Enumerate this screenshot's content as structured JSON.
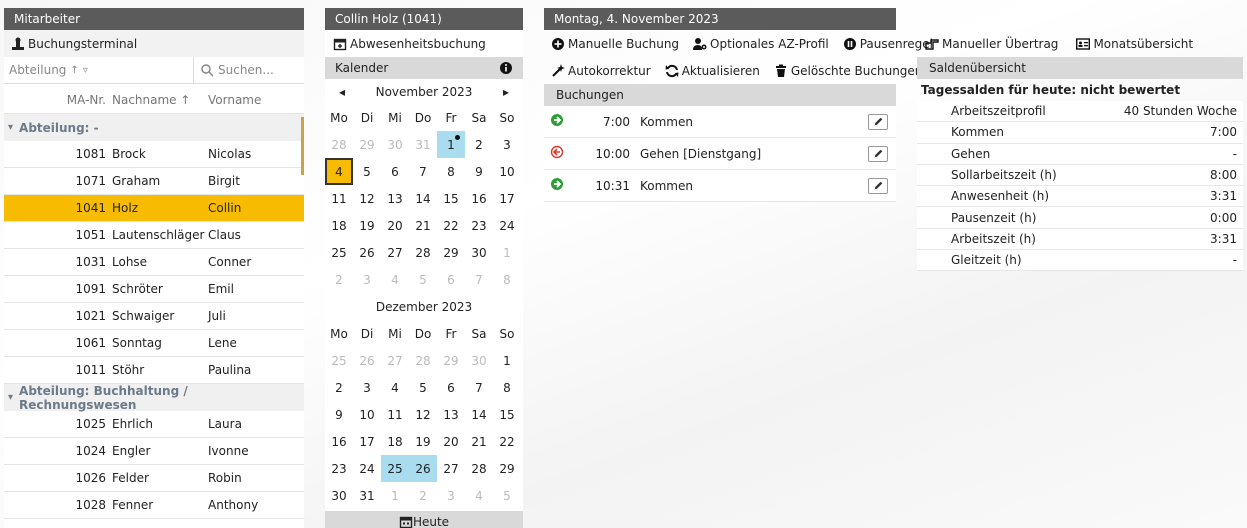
{
  "colors": {
    "accent": "#f7bc00",
    "header": "#5b5b5b",
    "highlight": "#a8dcee",
    "green": "#2e9e3a",
    "red": "#d9382b"
  },
  "mitarbeiter": {
    "header": "Mitarbeiter",
    "toolbar_label": "Buchungsterminal",
    "filter_label": "Abteilung",
    "search_placeholder": "Suchen...",
    "columns": {
      "nr": "MA-Nr.",
      "nachname": "Nachname",
      "vorname": "Vorname"
    },
    "groups": [
      {
        "label": "Abteilung: -",
        "rows": [
          {
            "nr": "1081",
            "nachname": "Brock",
            "vorname": "Nicolas"
          },
          {
            "nr": "1071",
            "nachname": "Graham",
            "vorname": "Birgit"
          },
          {
            "nr": "1041",
            "nachname": "Holz",
            "vorname": "Collin"
          },
          {
            "nr": "1051",
            "nachname": "Lautenschläger",
            "vorname": "Claus"
          },
          {
            "nr": "1031",
            "nachname": "Lohse",
            "vorname": "Conner"
          },
          {
            "nr": "1091",
            "nachname": "Schröter",
            "vorname": "Emil"
          },
          {
            "nr": "1021",
            "nachname": "Schwaiger",
            "vorname": "Juli"
          },
          {
            "nr": "1061",
            "nachname": "Sonntag",
            "vorname": "Lene"
          },
          {
            "nr": "1011",
            "nachname": "Stöhr",
            "vorname": "Paulina"
          }
        ]
      },
      {
        "label": "Abteilung: Buchhaltung / Rechnungswesen",
        "rows": [
          {
            "nr": "1025",
            "nachname": "Ehrlich",
            "vorname": "Laura"
          },
          {
            "nr": "1024",
            "nachname": "Engler",
            "vorname": "Ivonne"
          },
          {
            "nr": "1026",
            "nachname": "Felder",
            "vorname": "Robin"
          },
          {
            "nr": "1028",
            "nachname": "Fenner",
            "vorname": "Anthony"
          }
        ]
      }
    ],
    "selected_nr": "1041"
  },
  "calendar": {
    "header": "Collin Holz (1041)",
    "toolbar_label": "Abwesenheitsbuchung",
    "sub_label": "Kalender",
    "weekdays": [
      "Mo",
      "Di",
      "Mi",
      "Do",
      "Fr",
      "Sa",
      "So"
    ],
    "today_label": "Heute",
    "months": [
      {
        "title": "November 2023",
        "nav": true,
        "days": [
          {
            "d": "28",
            "o": true
          },
          {
            "d": "29",
            "o": true
          },
          {
            "d": "30",
            "o": true
          },
          {
            "d": "31",
            "o": true
          },
          {
            "d": "1",
            "hl": true,
            "dot": true
          },
          {
            "d": "2"
          },
          {
            "d": "3"
          },
          {
            "d": "4",
            "today": true
          },
          {
            "d": "5"
          },
          {
            "d": "6"
          },
          {
            "d": "7"
          },
          {
            "d": "8"
          },
          {
            "d": "9"
          },
          {
            "d": "10"
          },
          {
            "d": "11"
          },
          {
            "d": "12"
          },
          {
            "d": "13"
          },
          {
            "d": "14"
          },
          {
            "d": "15"
          },
          {
            "d": "16"
          },
          {
            "d": "17"
          },
          {
            "d": "18"
          },
          {
            "d": "19"
          },
          {
            "d": "20"
          },
          {
            "d": "21"
          },
          {
            "d": "22"
          },
          {
            "d": "23"
          },
          {
            "d": "24"
          },
          {
            "d": "25"
          },
          {
            "d": "26"
          },
          {
            "d": "27"
          },
          {
            "d": "28"
          },
          {
            "d": "29"
          },
          {
            "d": "30"
          },
          {
            "d": "1",
            "o": true
          },
          {
            "d": "2",
            "o": true
          },
          {
            "d": "3",
            "o": true
          },
          {
            "d": "4",
            "o": true
          },
          {
            "d": "5",
            "o": true
          },
          {
            "d": "6",
            "o": true
          },
          {
            "d": "7",
            "o": true
          },
          {
            "d": "8",
            "o": true
          }
        ]
      },
      {
        "title": "Dezember 2023",
        "nav": false,
        "days": [
          {
            "d": "25",
            "o": true
          },
          {
            "d": "26",
            "o": true
          },
          {
            "d": "27",
            "o": true
          },
          {
            "d": "28",
            "o": true
          },
          {
            "d": "29",
            "o": true
          },
          {
            "d": "30",
            "o": true
          },
          {
            "d": "1"
          },
          {
            "d": "2"
          },
          {
            "d": "3"
          },
          {
            "d": "4"
          },
          {
            "d": "5"
          },
          {
            "d": "6"
          },
          {
            "d": "7"
          },
          {
            "d": "8"
          },
          {
            "d": "9"
          },
          {
            "d": "10"
          },
          {
            "d": "11"
          },
          {
            "d": "12"
          },
          {
            "d": "13"
          },
          {
            "d": "14"
          },
          {
            "d": "15"
          },
          {
            "d": "16"
          },
          {
            "d": "17"
          },
          {
            "d": "18"
          },
          {
            "d": "19"
          },
          {
            "d": "20"
          },
          {
            "d": "21"
          },
          {
            "d": "22"
          },
          {
            "d": "23"
          },
          {
            "d": "24"
          },
          {
            "d": "25",
            "hl": true
          },
          {
            "d": "26",
            "hl": true
          },
          {
            "d": "27"
          },
          {
            "d": "28"
          },
          {
            "d": "29"
          },
          {
            "d": "30"
          },
          {
            "d": "31"
          },
          {
            "d": "1",
            "o": true
          },
          {
            "d": "2",
            "o": true
          },
          {
            "d": "3",
            "o": true
          },
          {
            "d": "4",
            "o": true
          },
          {
            "d": "5",
            "o": true
          }
        ]
      }
    ]
  },
  "day": {
    "header": "Montag, 4. November 2023",
    "toolbar": {
      "manual_booking": "Manuelle Buchung",
      "optional_profile": "Optionales AZ-Profil",
      "pause_rule": "Pausenregel",
      "auto_correct": "Autokorrektur",
      "refresh": "Aktualisieren",
      "deleted": "Gelöschte Buchungen"
    },
    "bookings_label": "Buchungen",
    "bookings": [
      {
        "icon": "arrow-in-icon",
        "time": "7:00",
        "label": "Kommen"
      },
      {
        "icon": "arrow-out-icon",
        "time": "10:00",
        "label": "Gehen [Dienstgang]"
      },
      {
        "icon": "arrow-in-icon",
        "time": "10:31",
        "label": "Kommen"
      }
    ]
  },
  "balances": {
    "toolbar": {
      "manual_transfer": "Manueller Übertrag",
      "month_overview": "Monatsübersicht"
    },
    "sub_label": "Saldenübersicht",
    "day_status": "Tagessalden für heute: nicht bewertet",
    "rows": [
      {
        "label": "Arbeitszeitprofil",
        "value": "40 Stunden Woche"
      },
      {
        "label": "Kommen",
        "value": "7:00"
      },
      {
        "label": "Gehen",
        "value": "-"
      },
      {
        "label": "Sollarbeitszeit (h)",
        "value": "8:00"
      },
      {
        "label": "Anwesenheit (h)",
        "value": "3:31"
      },
      {
        "label": "Pausenzeit (h)",
        "value": "0:00"
      },
      {
        "label": "Arbeitszeit (h)",
        "value": "3:31"
      },
      {
        "label": "Gleitzeit (h)",
        "value": "-"
      }
    ]
  }
}
